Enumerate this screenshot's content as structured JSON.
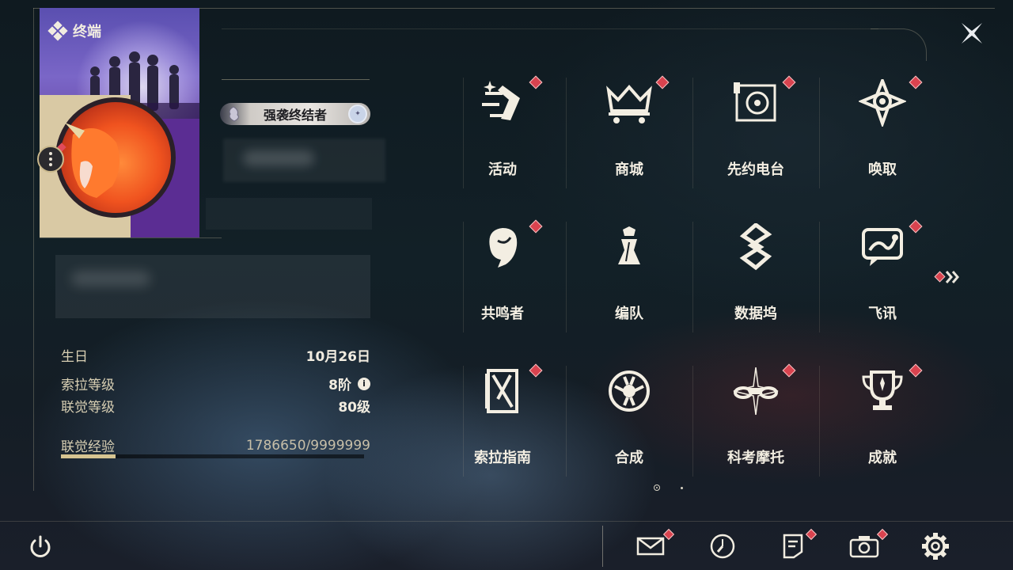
{
  "header": {
    "title": "终端",
    "title_icon": "diamond-cluster-icon",
    "close_icon": "close-icon"
  },
  "profile": {
    "badge": "强袭终结者",
    "badge_icon_left": "dragon-crest-icon",
    "badge_icon_right": "emblem-icon",
    "more_icon": "more-vertical-icon"
  },
  "stats": {
    "birthday_label": "生日",
    "birthday_value": "10月26日",
    "sola_level_label": "索拉等级",
    "sola_level_value": "8阶",
    "union_level_label": "联觉等级",
    "union_level_value": "80级",
    "exp_label": "联觉经验",
    "exp_value": "1786650/9999999",
    "exp_progress": 0.18
  },
  "menu": {
    "items": [
      {
        "label": "活动",
        "icon": "event-icon",
        "notify": true
      },
      {
        "label": "商城",
        "icon": "shop-crown-cart-icon",
        "notify": true
      },
      {
        "label": "先约电台",
        "icon": "radio-icon",
        "notify": true
      },
      {
        "label": "唤取",
        "icon": "convene-compass-icon",
        "notify": true
      },
      {
        "label": "共鸣者",
        "icon": "resonator-portrait-icon",
        "notify": true
      },
      {
        "label": "编队",
        "icon": "chess-team-icon",
        "notify": false
      },
      {
        "label": "数据坞",
        "icon": "data-bank-icon",
        "notify": false
      },
      {
        "label": "飞讯",
        "icon": "message-chat-icon",
        "notify": true
      },
      {
        "label": "索拉指南",
        "icon": "guide-book-icon",
        "notify": true
      },
      {
        "label": "合成",
        "icon": "synthesis-icon",
        "notify": false
      },
      {
        "label": "科考摩托",
        "icon": "motorcycle-icon",
        "notify": true
      },
      {
        "label": "成就",
        "icon": "trophy-icon",
        "notify": true
      }
    ],
    "next_icon": "double-chevron-right-icon",
    "page": 1,
    "pages": 2
  },
  "bottom_bar": {
    "power_icon": "power-icon",
    "icons": [
      "mail-icon",
      "clock-icon",
      "notice-icon",
      "camera-icon",
      "settings-gear-icon"
    ]
  },
  "colors": {
    "accent_gold": "#d6c491",
    "notify_red": "#d9434f",
    "text": "#f3eee2"
  }
}
